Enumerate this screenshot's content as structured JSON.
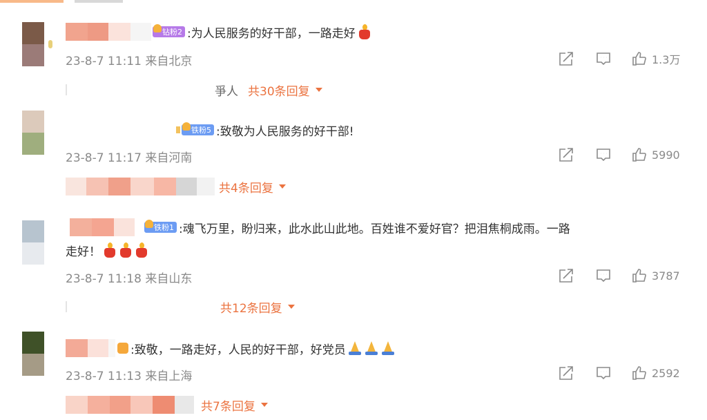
{
  "comments": [
    {
      "badge_text": "钻粉2",
      "badge_color": "#b67ae8",
      "text": ":为人民服务的好干部，一路走好",
      "emojis": [
        "candle"
      ],
      "meta": "23-8-7 11:11 来自北京",
      "likes": "1.3万",
      "reply_prefix": "爭人",
      "reply_label": "共30条回复"
    },
    {
      "badge_text": "铁粉5",
      "badge_color": "#6c9cf3",
      "text": ":致敬为人民服务的好干部!",
      "emojis": [],
      "meta": "23-8-7 11:17 来自河南",
      "likes": "5990",
      "reply_label": "共4条回复"
    },
    {
      "badge_text": "铁粉1",
      "badge_color": "#6c9cf3",
      "text": ":魂飞万里，盼归来，此水此山此地。百姓谁不爱好官？把泪焦桐成雨。一路",
      "text2": "走好！",
      "emojis": [
        "candle",
        "candle",
        "candle"
      ],
      "meta": "23-8-7 11:18 来自山东",
      "likes": "3787",
      "reply_label": "共12条回复"
    },
    {
      "text": ":致敬，一路走好，人民的好干部，好党员",
      "emojis": [
        "pray",
        "pray",
        "pray"
      ],
      "meta": "23-8-7 11:13 来自上海",
      "likes": "2592",
      "reply_label": "共7条回复"
    }
  ]
}
